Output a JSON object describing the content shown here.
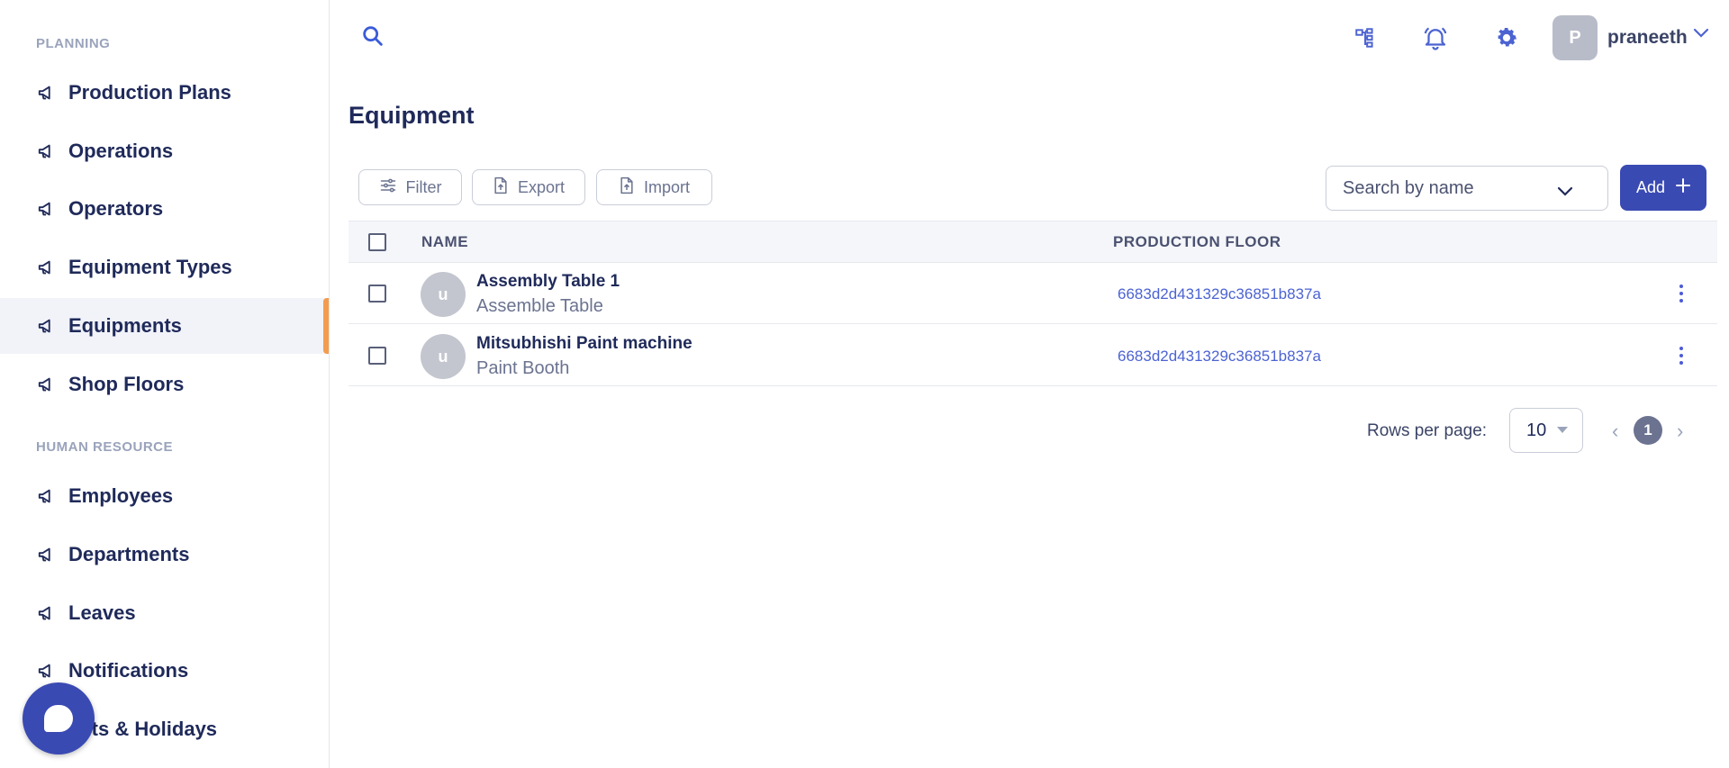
{
  "sidebar": {
    "sections": [
      {
        "title": "PLANNING"
      },
      {
        "title": "HUMAN RESOURCE"
      }
    ],
    "items": [
      {
        "label": "Production Plans"
      },
      {
        "label": "Operations"
      },
      {
        "label": "Operators"
      },
      {
        "label": "Equipment Types"
      },
      {
        "label": "Equipments",
        "active": true
      },
      {
        "label": "Shop Floors"
      },
      {
        "label": "Employees"
      },
      {
        "label": "Departments"
      },
      {
        "label": "Leaves"
      },
      {
        "label": "Notifications"
      },
      {
        "label": "ents & Holidays"
      }
    ],
    "icon": "megaphone-icon"
  },
  "topbar": {
    "user_initial": "P",
    "username": "praneeth",
    "icons": [
      "search-icon",
      "hierarchy-icon",
      "bell-icon",
      "gear-icon",
      "chevron-down-icon"
    ]
  },
  "page": {
    "title": "Equipment"
  },
  "toolbar": {
    "filter_label": "Filter",
    "export_label": "Export",
    "import_label": "Import",
    "search_placeholder": "Search by name",
    "add_label": "Add"
  },
  "table": {
    "columns": [
      "NAME",
      "PRODUCTION FLOOR"
    ],
    "rows": [
      {
        "initial": "u",
        "name": "Assembly Table 1",
        "type": "Assemble Table",
        "floor": "6683d2d431329c36851b837a"
      },
      {
        "initial": "u",
        "name": "Mitsubhishi Paint machine",
        "type": "Paint Booth",
        "floor": "6683d2d431329c36851b837a"
      }
    ]
  },
  "pagination": {
    "rows_label": "Rows per page:",
    "rows_value": "10",
    "current_page": "1"
  },
  "colors": {
    "accent": "#3a4ab3",
    "active_indicator": "#f39c4d",
    "link": "#4c63d2"
  }
}
